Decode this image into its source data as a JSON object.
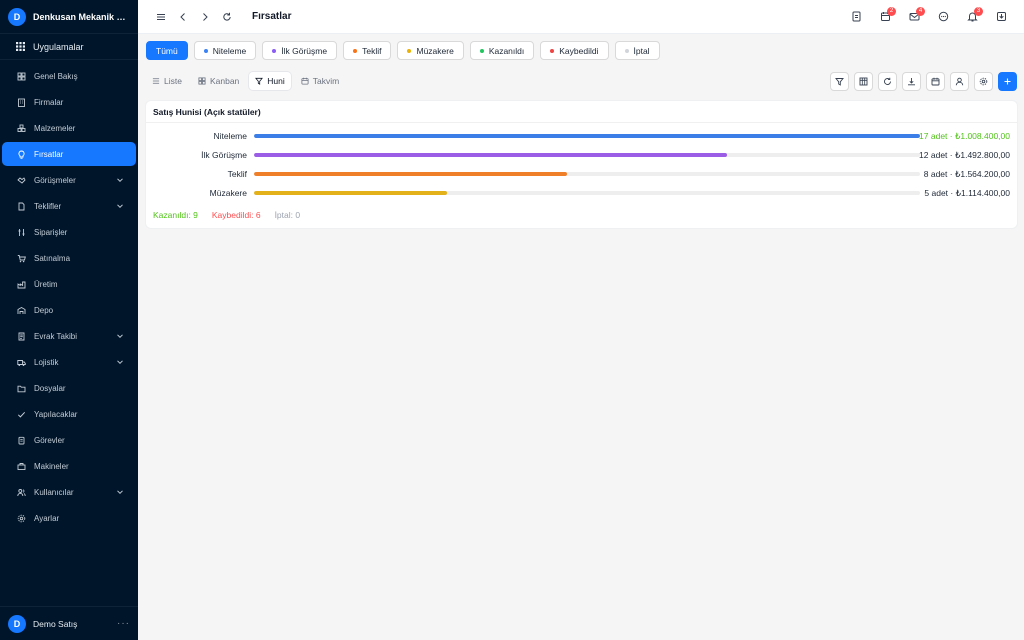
{
  "brand": {
    "initial": "D",
    "name": "Denkusan Mekanik San..."
  },
  "sidebar": {
    "apps_label": "Uygulamalar",
    "items": [
      {
        "label": "Genel Bakış",
        "icon": "dashboard-icon",
        "expandable": false,
        "active": false
      },
      {
        "label": "Firmalar",
        "icon": "building-icon",
        "expandable": false,
        "active": false
      },
      {
        "label": "Malzemeler",
        "icon": "boxes-icon",
        "expandable": false,
        "active": false
      },
      {
        "label": "Fırsatlar",
        "icon": "bulb-icon",
        "expandable": false,
        "active": true
      },
      {
        "label": "Görüşmeler",
        "icon": "handshake-icon",
        "expandable": true,
        "active": false
      },
      {
        "label": "Teklifler",
        "icon": "file-icon",
        "expandable": true,
        "active": false
      },
      {
        "label": "Siparişler",
        "icon": "order-icon",
        "expandable": false,
        "active": false
      },
      {
        "label": "Satınalma",
        "icon": "cart-icon",
        "expandable": false,
        "active": false
      },
      {
        "label": "Üretim",
        "icon": "factory-icon",
        "expandable": false,
        "active": false
      },
      {
        "label": "Depo",
        "icon": "warehouse-icon",
        "expandable": false,
        "active": false
      },
      {
        "label": "Evrak Takibi",
        "icon": "document-icon",
        "expandable": true,
        "active": false
      },
      {
        "label": "Lojistik",
        "icon": "truck-icon",
        "expandable": true,
        "active": false
      },
      {
        "label": "Dosyalar",
        "icon": "folder-icon",
        "expandable": false,
        "active": false
      },
      {
        "label": "Yapılacaklar",
        "icon": "check-icon",
        "expandable": false,
        "active": false
      },
      {
        "label": "Görevler",
        "icon": "task-icon",
        "expandable": false,
        "active": false
      },
      {
        "label": "Makineler",
        "icon": "machine-icon",
        "expandable": false,
        "active": false
      },
      {
        "label": "Kullanıcılar",
        "icon": "users-icon",
        "expandable": true,
        "active": false
      },
      {
        "label": "Ayarlar",
        "icon": "settings-icon",
        "expandable": false,
        "active": false
      }
    ]
  },
  "user": {
    "initial": "D",
    "name": "Demo Satış",
    "more": "···"
  },
  "header": {
    "title": "Fırsatlar",
    "badges": {
      "calendar": "2",
      "mail": "4",
      "bell": "3"
    }
  },
  "filters": [
    {
      "label": "Tümü",
      "active": true,
      "dot": ""
    },
    {
      "label": "Niteleme",
      "active": false,
      "dot": "#3b82f6"
    },
    {
      "label": "İlk Görüşme",
      "active": false,
      "dot": "#8b5cf6"
    },
    {
      "label": "Teklif",
      "active": false,
      "dot": "#f97316"
    },
    {
      "label": "Müzakere",
      "active": false,
      "dot": "#eab308"
    },
    {
      "label": "Kazanıldı",
      "active": false,
      "dot": "#22c55e"
    },
    {
      "label": "Kaybedildi",
      "active": false,
      "dot": "#ef4444"
    },
    {
      "label": "İptal",
      "active": false,
      "dot": "#d1d5db"
    }
  ],
  "views": [
    {
      "label": "Liste",
      "icon": "list-icon",
      "active": false
    },
    {
      "label": "Kanban",
      "icon": "kanban-icon",
      "active": false
    },
    {
      "label": "Huni",
      "icon": "funnel-icon",
      "active": true
    },
    {
      "label": "Takvim",
      "icon": "calendar-icon",
      "active": false
    }
  ],
  "funnel": {
    "title": "Satış Hunisi (Açık statüler)",
    "rows": [
      {
        "stage": "Niteleme",
        "fill": 1.0,
        "color": "#3b7ee8",
        "meta": "17 adet · ₺1.008.400,00",
        "meta_color": "#52c41a"
      },
      {
        "stage": "İlk Görüşme",
        "fill": 0.71,
        "color": "#9b5de5",
        "meta": "12 adet · ₺1.492.800,00",
        "meta_color": "#1f2937"
      },
      {
        "stage": "Teklif",
        "fill": 0.47,
        "color": "#f07f2a",
        "meta": "8 adet · ₺1.564.200,00",
        "meta_color": "#1f2937"
      },
      {
        "stage": "Müzakere",
        "fill": 0.29,
        "color": "#e3b119",
        "meta": "5 adet · ₺1.114.400,00",
        "meta_color": "#1f2937"
      }
    ],
    "summary": [
      {
        "text": "Kazanıldı: 9",
        "color": "#52c41a"
      },
      {
        "text": "Kaybedildi: 6",
        "color": "#ff4d4f"
      },
      {
        "text": "İptal: 0",
        "color": "#9ca3af"
      }
    ]
  }
}
